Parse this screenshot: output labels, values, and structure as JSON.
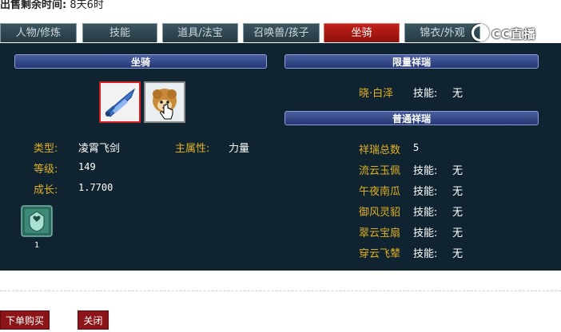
{
  "sale": {
    "label": "出售剩余时间:",
    "value": "8天6时"
  },
  "tabs": [
    {
      "label": "人物/修炼",
      "active": false
    },
    {
      "label": "技能",
      "active": false
    },
    {
      "label": "道具/法宝",
      "active": false
    },
    {
      "label": "召唤兽/孩子",
      "active": false
    },
    {
      "label": "坐骑",
      "active": true
    },
    {
      "label": "锦衣/外观",
      "active": false
    }
  ],
  "watermark": {
    "text": "CC直播",
    "icon": "cc-live-logo-icon"
  },
  "mount": {
    "header": "坐骑",
    "slots": [
      {
        "icon": "flying-sword-icon"
      },
      {
        "icon": "sheep-mount-icon"
      }
    ],
    "type_label": "类型:",
    "type_value": "凌霄飞剑",
    "attr_label": "主属性:",
    "attr_value": "力量",
    "level_label": "等级:",
    "level_value": "149",
    "growth_label": "成长:",
    "growth_value": "1.7700",
    "badge": {
      "icon": "mount-badge-icon",
      "count": "1"
    }
  },
  "limited": {
    "header": "限量祥瑞",
    "items": [
      {
        "name": "晓·白泽",
        "skill_label": "技能:",
        "skill_value": "无"
      }
    ]
  },
  "normal": {
    "header": "普通祥瑞",
    "total_label": "祥瑞总数",
    "total_value": "5",
    "items": [
      {
        "name": "流云玉佩",
        "skill_label": "技能:",
        "skill_value": "无"
      },
      {
        "name": "午夜南瓜",
        "skill_label": "技能:",
        "skill_value": "无"
      },
      {
        "name": "御风灵貂",
        "skill_label": "技能:",
        "skill_value": "无"
      },
      {
        "name": "翠云宝扇",
        "skill_label": "技能:",
        "skill_value": "无"
      },
      {
        "name": "穿云飞辇",
        "skill_label": "技能:",
        "skill_value": "无"
      }
    ]
  },
  "buttons": {
    "buy": "下单购买",
    "close": "关闭"
  },
  "colors": {
    "panel_bg": "#0f2430",
    "label": "#e0b023",
    "active_tab": "#c0221a",
    "button": "#8b1418"
  }
}
